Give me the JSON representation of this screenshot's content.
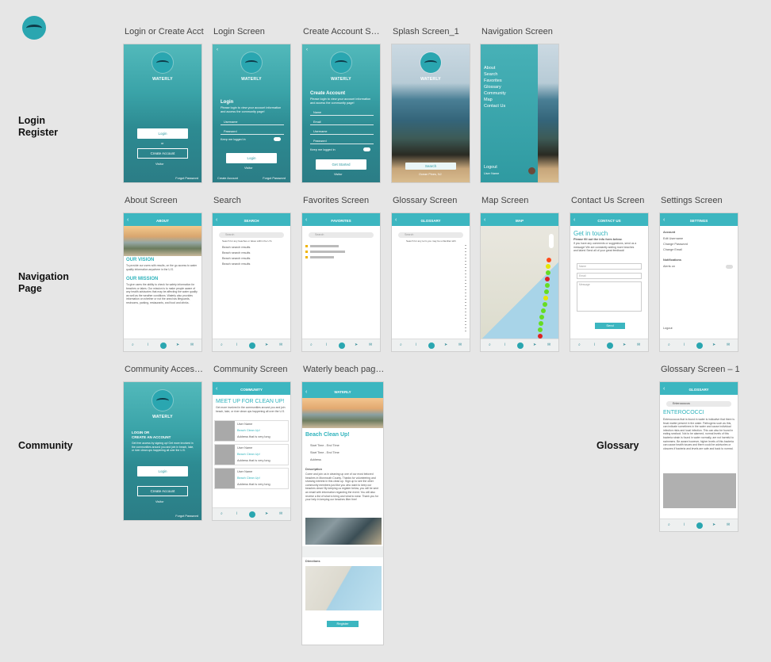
{
  "rows": {
    "login": "Login\nRegister",
    "navigation": "Navigation\nPage",
    "community": "Community",
    "glossary": "Glossary"
  },
  "frames": {
    "login_create": {
      "title": "Login or Create Acct",
      "brand": "WATERLY",
      "login": "Login",
      "create": "Create Account",
      "or": "or",
      "visitor": "Visitor",
      "forgot": "Forgot Password"
    },
    "login_screen": {
      "title": "Login Screen",
      "brand": "WATERLY",
      "heading": "Login",
      "text": "Please login to view your account information and access the community page!",
      "username": "Username",
      "password": "Password",
      "remember": "Keep me logged in",
      "login": "Login",
      "visitor": "Visitor",
      "create": "Create Account",
      "forgot": "Forgot Password"
    },
    "create_account": {
      "title": "Create Account Scr...",
      "brand": "WATERLY",
      "heading": "Create Account",
      "text": "Please login to view your account information and access the community page!",
      "name": "Name",
      "email": "Email",
      "username": "Username",
      "password": "Password",
      "remember": "Keep me logged in",
      "submit": "Get Started",
      "visitor": "Visitor"
    },
    "splash": {
      "title": "Splash Screen_1",
      "brand": "WATERLY",
      "search": "Search",
      "location": "Ocean Pines, NJ"
    },
    "navigation": {
      "title": "Navigation Screen",
      "items": [
        "About",
        "Search",
        "Favorites",
        "Glossary",
        "Community",
        "Map",
        "Contact Us"
      ],
      "logout": "Logout",
      "user": "User Name"
    },
    "about": {
      "title": "About Screen",
      "header": "ABOUT",
      "vision": "OUR VISION",
      "mission": "OUR MISSION",
      "vision_text": "To provide our users with results, on the go access to water quality information anywhere in the U.S.",
      "mission_text": "To give users the ability to check for safety information for beaches or lakes. Our mission is to make people aware of any health advisories that may be affecting the water quality as well as the weather conditions. Waterly also provides information on whether or not the area has lifeguards, restrooms, parking, restaurants, and food and drinks."
    },
    "search": {
      "title": "Search",
      "header": "SEARCH",
      "placeholder": "Search",
      "hint": "Search for any beaches or lakes within the U.S.",
      "results": [
        "Beach search results",
        "Beach search results",
        "Beach search results",
        "Beach search results"
      ]
    },
    "favorites": {
      "title": "Favorites Screen",
      "header": "FAVORITES",
      "placeholder": "Search"
    },
    "glossary": {
      "title": "Glossary Screen",
      "header": "GLOSSARY",
      "placeholder": "Search",
      "hint": "Search for any term you may be unfamiliar with"
    },
    "map": {
      "title": "Map Screen",
      "header": "MAP"
    },
    "contact": {
      "title": "Contact Us Screen",
      "header": "CONTACT US",
      "heading": "Get in touch",
      "sub": "Please fill out the info form below.",
      "text": "If you have any comments or suggestions, send us a message! We are constantly adding more beaches and lakes! Send all of your great feedback!",
      "name": "Name",
      "email": "Email",
      "message": "Message",
      "send": "Send"
    },
    "settings": {
      "title": "Settings Screen",
      "header": "SETTINGS",
      "account": "Account",
      "items": [
        "Edit Username",
        "Change Password",
        "Change Email"
      ],
      "notifications": "Notifications",
      "alert": "Alerts on",
      "logout": "Logout"
    },
    "community_access": {
      "title": "Community Access...",
      "brand": "WATERLY",
      "heading": "LOGIN OR\nCREATE AN ACCOUNT",
      "text": "Get free access by signing up! Get more involved in the communities around you and join in beach, lake, or river clean ups happening all over the U.S.",
      "login": "Login",
      "create": "Create Account",
      "visitor": "Visitor",
      "forgot": "Forgot Password"
    },
    "community": {
      "title": "Community Screen",
      "header": "COMMUNITY",
      "heading": "MEET UP FOR CLEAN UP!",
      "text": "Get more involved in the communities around you and join beach, lake, or river clean ups happening all over the U.S.",
      "cards": [
        {
          "user": "User Name",
          "event": "Beach Clean Up!",
          "addr": "Address that is very long"
        },
        {
          "user": "User Name",
          "event": "Beach Clean Up!",
          "addr": "Address that is very long"
        },
        {
          "user": "User Name",
          "event": "Beach Clean Up!",
          "addr": "Address that is very long"
        }
      ]
    },
    "beach_page": {
      "title": "Waterly beach page...",
      "header": "WATERLY",
      "event": "Beach Clean Up!",
      "info": [
        "Start Time - End Time",
        "Start Time - End Time",
        "Address"
      ],
      "desc_title": "Description",
      "desc": "Come and join us in cleaning up one of our most beloved beaches in Monmouth County. Thanks for volunteering and showing interest in this clean up. Sign up to see the other community members just like you who want to keep our beaches clean! By keeping us register below, you will be sent an email with information regarding the event. You will also receive a list of what to bring and what to wear. Thank you for your help in keeping our beaches litter free!",
      "directions": "Directions",
      "register": "Register"
    },
    "glossary_detail": {
      "title": "Glossary Screen – 1",
      "header": "GLOSSARY",
      "search_value": "Enterococcus",
      "term": "ENTEROCOCCI",
      "def": "Enterococcus that is found in water is indicative that there is fecal matter present in the water. Pathogens such as this, can indicate sometimes in the water and cause individual infection risks and local infection. This can also be found in eating seafood. Not to be alarmed, normal levels of this bacteria strain is found in water normally, are not harmful to swimmers. Be aware however, higher levels of this bacteria can cause health issues and there could be advisories or closures if bacteria and levels are safe and back to normal."
    }
  }
}
